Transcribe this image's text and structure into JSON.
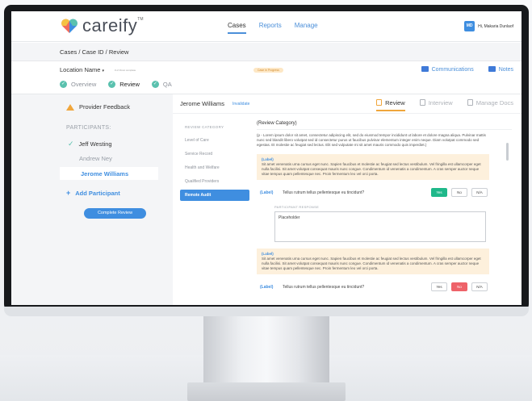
{
  "app": {
    "name": "careify",
    "tm": "TM"
  },
  "nav": {
    "cases": "Cases",
    "reports": "Reports",
    "manage": "Manage"
  },
  "user": {
    "initials": "MD",
    "greeting": "Hi, Makaria Dunlaof"
  },
  "breadcrumb": "Cases / Case ID / Review",
  "location": {
    "name": "Location Name",
    "chevron": "▾",
    "sub": "# of thinot complete",
    "status": "Case in Progress"
  },
  "top_actions": {
    "communications": "Communications",
    "notes": "Notes"
  },
  "steps": [
    {
      "label": "Overview"
    },
    {
      "label": "Review"
    },
    {
      "label": "QA"
    }
  ],
  "sidebar": {
    "feedback": "Provider Feedback",
    "participants_label": "PARTICIPANTS:",
    "participants": [
      "Jeff Westing",
      "Andrew Ney",
      "Jerome Williams"
    ],
    "add": "Add Participant",
    "complete": "Complete Review"
  },
  "main": {
    "patient": "Jerome Williams",
    "invalidate": "Invalidate",
    "tabs": [
      "Review",
      "Interview",
      "Manage Docs"
    ],
    "categories_title": "REVIEW CATEGORY",
    "categories": [
      "Level of Care",
      "Service Record",
      "Health and Welfare",
      "Qualified Providers",
      "Remote Audit"
    ],
    "review_category": "(Review Category)",
    "intro": "(p - Lorem ipsum dolor sit amet, consectetur adipiscing elit, sed do eiusmod tempor incididunt ut labore et dolore magna aliqua. Pulvinar mattis nunc sed blandit libero volutpat sed id consectetur purus ut faucibus pulvinar elementum integer enim neque. Diam volutpat commodo sed egestas. Et molestie ac feugiat sed lectus. Elit sed vulputate mi sit amet mauris commodo quis imperdiet.)",
    "label_tag": "(Label)",
    "label_text": "Sit amet venenatis urna cursus eget nunc. Sapien faucibus et molestie ac feugiat sed lectus vestibulum. Vel fringilla est ullamcorper eget nulla facilisi. Sit amet volutpat consequat mauris nunc congue. Condimentum id venenatis a condimentum. A cras semper auctor neque vitae tempus quam pellentesque nec. Proin fermentum leo vel orci porta.",
    "q1": "Tellus rutrum tellus pellentesque eu tincidunt?",
    "q2": "Tellus rutrum tellus pellentesque eu tincidunt?",
    "yes": "Yes",
    "no": "No",
    "na": "N/A",
    "participant_response": "PARTICIPANT RESPONSE",
    "placeholder": "Placeholder"
  },
  "colors": {
    "accent": "#3f8ee0",
    "success": "#1fb88a",
    "danger": "#ee6269",
    "warning": "#f0a63c",
    "highlight": "#fdf0dc"
  }
}
